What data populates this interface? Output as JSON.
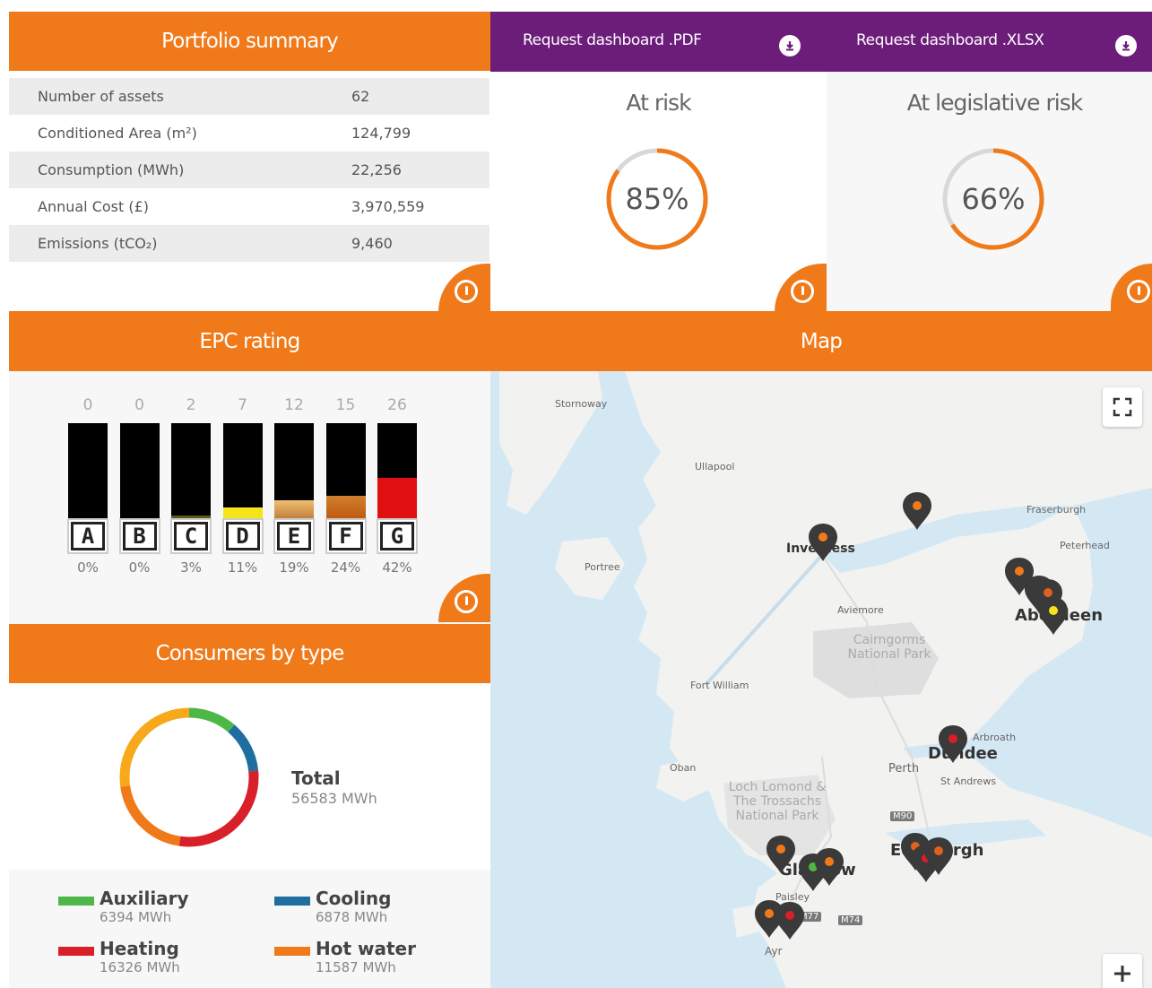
{
  "portfolio": {
    "title": "Portfolio summary",
    "rows": [
      {
        "label": "Number of assets",
        "value": "62"
      },
      {
        "label": "Conditioned Area (m²)",
        "value": "124,799"
      },
      {
        "label": "Consumption (MWh)",
        "value": "22,256"
      },
      {
        "label": "Annual Cost (£)",
        "value": "3,970,559"
      },
      {
        "label": "Emissions (tCO₂)",
        "value": "9,460"
      }
    ]
  },
  "downloads": {
    "pdf_label": "Request dashboard .PDF",
    "xlsx_label": "Request dashboard .XLSX"
  },
  "at_risk": {
    "title": "At risk",
    "value_text": "85%",
    "fraction": 0.85
  },
  "legislative_risk": {
    "title": "At legislative risk",
    "value_text": "66%",
    "fraction": 0.66
  },
  "epc": {
    "title": "EPC rating",
    "bands": [
      {
        "letter": "A",
        "count": "0",
        "pct": "0%",
        "fraction": 0.0,
        "color": "#000000"
      },
      {
        "letter": "B",
        "count": "0",
        "pct": "0%",
        "fraction": 0.0,
        "color": "#000000"
      },
      {
        "letter": "C",
        "count": "2",
        "pct": "3%",
        "fraction": 0.03,
        "color": "#5a5a1a"
      },
      {
        "letter": "D",
        "count": "7",
        "pct": "11%",
        "fraction": 0.11,
        "color": "#f4e41a"
      },
      {
        "letter": "E",
        "count": "12",
        "pct": "19%",
        "fraction": 0.19,
        "color": "#e9b46a"
      },
      {
        "letter": "F",
        "count": "15",
        "pct": "24%",
        "fraction": 0.24,
        "color": "#e0782a"
      },
      {
        "letter": "G",
        "count": "26",
        "pct": "42%",
        "fraction": 0.42,
        "color": "#e01010"
      }
    ]
  },
  "consumers": {
    "title": "Consumers by type",
    "total_label": "Total",
    "total_value": "56583 MWh",
    "items": [
      {
        "name": "Auxiliary",
        "value": "6394 MWh",
        "mwh": 6394,
        "color": "#4db848"
      },
      {
        "name": "Cooling",
        "value": "6878 MWh",
        "mwh": 6878,
        "color": "#1e6ea0"
      },
      {
        "name": "Heating",
        "value": "16326 MWh",
        "mwh": 16326,
        "color": "#d81f2a"
      },
      {
        "name": "Hot water",
        "value": "11587 MWh",
        "mwh": 11587,
        "color": "#f07a1a"
      }
    ],
    "other_color": "#f7a81b"
  },
  "map": {
    "title": "Map",
    "labels": {
      "stornoway": "Stornoway",
      "ullapool": "Ullapool",
      "fraserburgh": "Fraserburgh",
      "peterhead": "Peterhead",
      "portree": "Portree",
      "aviemore": "Aviemore",
      "fort_william": "Fort William",
      "oban": "Oban",
      "perth": "Perth",
      "arbroath": "Arbroath",
      "st_andrews": "St Andrews",
      "ayr": "Ayr",
      "paisley": "Paisley",
      "inverness": "Inverness",
      "aberdeen": "Aberdeen",
      "dundee": "Dundee",
      "edinburgh": "Edinburgh",
      "glasgow": "Glasgow",
      "cairngorms": "Cairngorms National Park",
      "loch_lomond": "Loch Lomond & The Trossachs National Park",
      "m90": "M90",
      "m77": "M77",
      "m74": "M74"
    }
  }
}
